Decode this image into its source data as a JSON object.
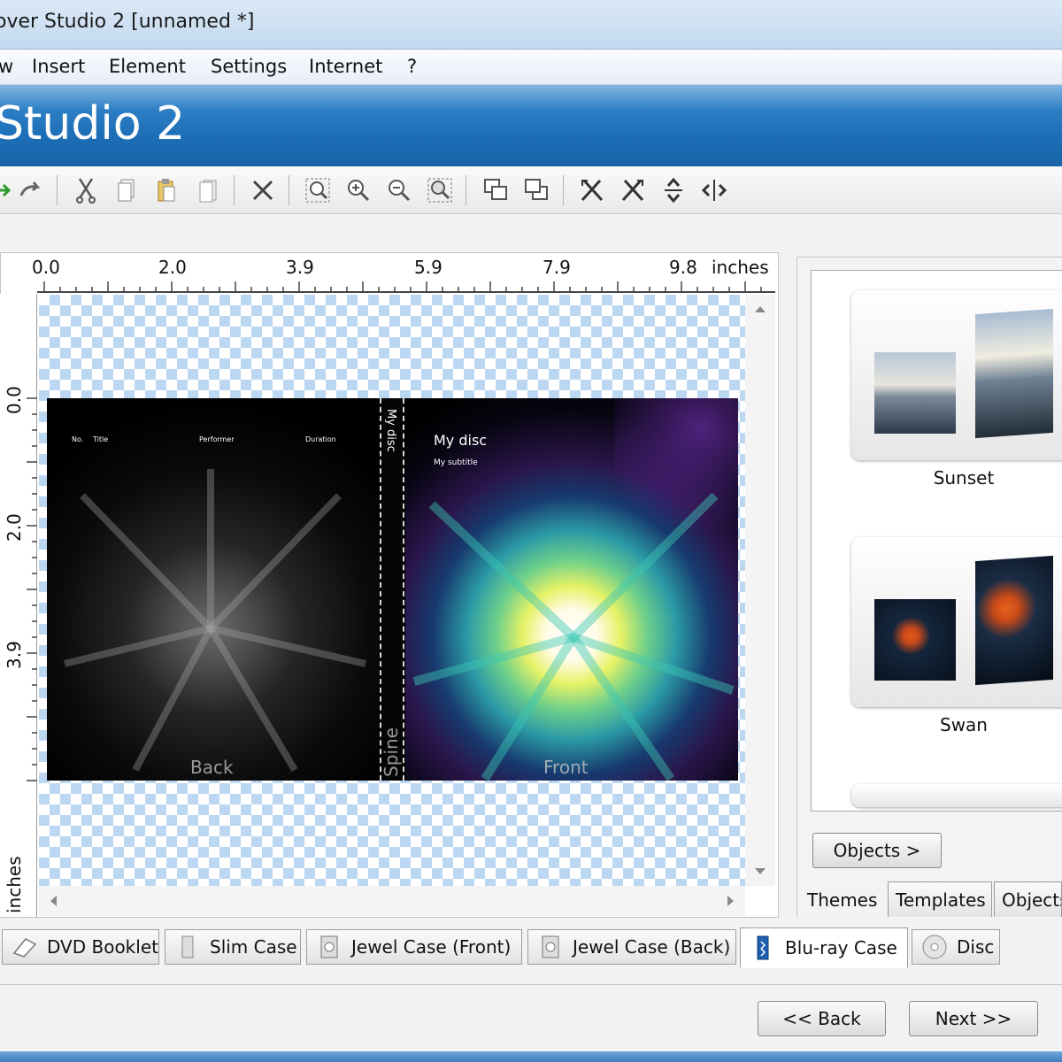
{
  "window": {
    "title": "over Studio 2 [unnamed *]"
  },
  "menu": [
    "w",
    "Insert",
    "Element",
    "Settings",
    "Internet",
    "?"
  ],
  "banner": {
    "title": "Studio 2"
  },
  "toolbar": {
    "icons": [
      "arrow-green-icon",
      "redo-icon",
      "cut-icon",
      "copy-icon",
      "paste-icon",
      "duplicate-icon",
      "delete-icon",
      "zoom-fit-icon",
      "zoom-in-icon",
      "zoom-out-icon",
      "zoom-actual-icon",
      "bring-front-icon",
      "send-back-icon",
      "flip-left-icon",
      "flip-right-icon",
      "flip-vertical-icon",
      "flip-horizontal-icon"
    ]
  },
  "ruler": {
    "top_labels": [
      "0.0",
      "2.0",
      "3.9",
      "5.9",
      "7.9",
      "9.8"
    ],
    "top_unit": "inches",
    "left_labels": [
      "0.0",
      "2.0",
      "3.9"
    ],
    "left_unit": "inches"
  },
  "cover": {
    "back_columns": [
      "No.",
      "Title",
      "Performer",
      "Duration"
    ],
    "back_label": "Back",
    "spine_title": "My disc",
    "spine_label": "Spine",
    "front_title": "My disc",
    "front_subtitle": "My subtitle",
    "front_label": "Front"
  },
  "themes": [
    {
      "name": "Sunset"
    },
    {
      "name": "Swan"
    }
  ],
  "side_panel": {
    "objects_button": "Objects >",
    "tabs": [
      "Themes",
      "Templates",
      "Objects"
    ]
  },
  "case_tabs": [
    {
      "label": "DVD Booklet",
      "icon": "booklet-icon"
    },
    {
      "label": "Slim Case",
      "icon": "slim-case-icon"
    },
    {
      "label": "Jewel Case (Front)",
      "icon": "jewel-case-front-icon"
    },
    {
      "label": "Jewel Case (Back)",
      "icon": "jewel-case-back-icon"
    },
    {
      "label": "Blu-ray Case",
      "icon": "bluray-case-icon"
    },
    {
      "label": "Disc",
      "icon": "disc-icon"
    }
  ],
  "nav": {
    "back": "<< Back",
    "next": "Next >>"
  }
}
